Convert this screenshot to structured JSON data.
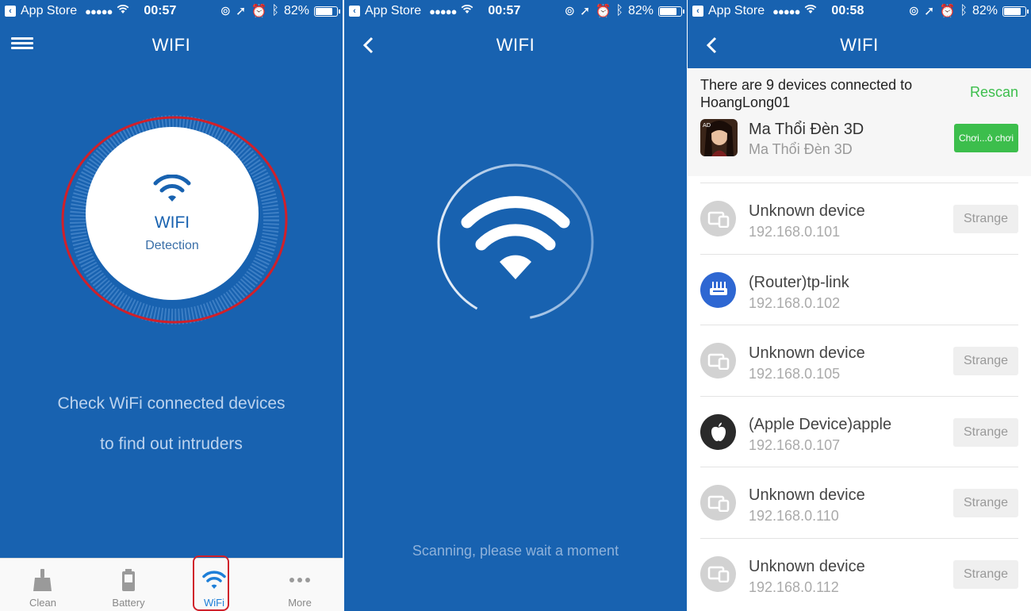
{
  "status_bars": [
    {
      "back_app": "App Store",
      "time": "00:57",
      "battery": "82%"
    },
    {
      "back_app": "App Store",
      "time": "00:57",
      "battery": "82%"
    },
    {
      "back_app": "App Store",
      "time": "00:58",
      "battery": "82%"
    }
  ],
  "screen1": {
    "title": "WIFI",
    "dial_title": "WIFI",
    "dial_subtitle": "Detection",
    "line1": "Check WiFi connected devices",
    "line2": "to find out intruders",
    "tabs": [
      {
        "label": "Clean",
        "icon": "broom-icon"
      },
      {
        "label": "Battery",
        "icon": "battery-icon"
      },
      {
        "label": "WiFi",
        "icon": "wifi-icon"
      },
      {
        "label": "More",
        "icon": "more-dots-icon"
      }
    ],
    "active_tab": "WiFi"
  },
  "screen2": {
    "title": "WIFI",
    "scan_text": "Scanning, please wait a moment"
  },
  "screen3": {
    "title": "WIFI",
    "message": "There are 9 devices connected to HoangLong01",
    "rescan": "Rescan",
    "ad": {
      "title": "Ma Thổi Đèn 3D",
      "subtitle": "Ma Thổi Đèn 3D",
      "button": "Chơi...ò chơi"
    },
    "devices": [
      {
        "name": "Unknown device",
        "ip": "192.168.0.101",
        "type": "unknown",
        "action": "Strange"
      },
      {
        "name": "(Router)tp-link",
        "ip": "192.168.0.102",
        "type": "router",
        "action": ""
      },
      {
        "name": "Unknown device",
        "ip": "192.168.0.105",
        "type": "unknown",
        "action": "Strange"
      },
      {
        "name": "(Apple Device)apple",
        "ip": "192.168.0.107",
        "type": "apple",
        "action": "Strange"
      },
      {
        "name": "Unknown device",
        "ip": "192.168.0.110",
        "type": "unknown",
        "action": "Strange"
      },
      {
        "name": "Unknown device",
        "ip": "192.168.0.112",
        "type": "unknown",
        "action": "Strange"
      }
    ]
  },
  "colors": {
    "brand_blue": "#1862b0",
    "accent_green": "#3cbe4c",
    "highlight_red": "#d0202a"
  }
}
